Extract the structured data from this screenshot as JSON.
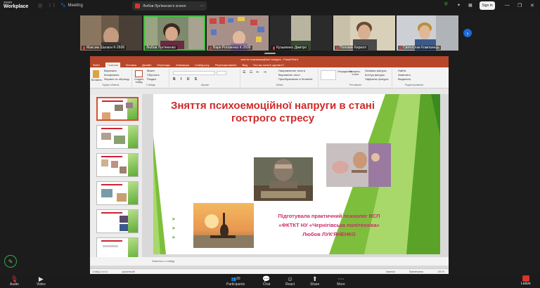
{
  "app": {
    "brand_top": "zoom",
    "brand_main": "Workplace",
    "meeting_label": "Meeting"
  },
  "share": {
    "title": "Любов Лук'яненко's screen"
  },
  "top_actions": {
    "sign_in": "Sign in"
  },
  "participants": [
    {
      "name": "Максим Шалаги К-2606",
      "muted": true
    },
    {
      "name": "Любов Лук'яненко",
      "muted": false,
      "active": true
    },
    {
      "name": "Варя Роговенко К-2606",
      "muted": true
    },
    {
      "name": "Кузьменко Дмитро",
      "muted": true
    },
    {
      "name": "Поповик Кирилл",
      "muted": true
    },
    {
      "name": "Святослав Компанець",
      "muted": true
    }
  ],
  "ppt": {
    "window_title": "зняття психоемоційної напруги - PowerPoint",
    "tabs": [
      "Файл",
      "Главная",
      "Вставка",
      "Дизайн",
      "Переходы",
      "Анимация",
      "Слайд-шоу",
      "Рецензирование",
      "Вид",
      "Что вы хотите сделать?"
    ],
    "selected_tab": "Главная",
    "ribbon_groups": {
      "clipboard": {
        "label": "Буфер обмена",
        "items": [
          "Вырезать",
          "Копировать",
          "Формат по образцу"
        ],
        "paste": "Вставить"
      },
      "slides": {
        "label": "Слайды",
        "items": [
          "Макет",
          "Сбросить",
          "Раздел"
        ],
        "new": "Создать слайд"
      },
      "font": {
        "label": "Шрифт"
      },
      "paragraph": {
        "label": "Абзац",
        "items": [
          "Направление текста",
          "Выровнять текст",
          "Преобразовать в SmartArt"
        ]
      },
      "drawing": {
        "label": "Рисование",
        "items": [
          "Упорядочить",
          "Экспресс-стили",
          "Заливка фигуры",
          "Контур фигуры",
          "Эффекты фигуры"
        ]
      },
      "editing": {
        "label": "Редактирование",
        "items": [
          "Найти",
          "Заменить",
          "Выделить"
        ]
      }
    },
    "slide": {
      "title": "Зняття психоемоційної напруги в стані гострого стресу",
      "info_lines": [
        "Підготувала практичний психолог ВСП",
        "«ФКТКТ НУ «Чернігівська політехніка»",
        "Любов ЛУК'ЯНЕНКО"
      ],
      "bullet": "➤"
    },
    "slide_count": 7,
    "notes_placeholder": "Заметки к слайду",
    "status": {
      "slide_of": "Слайд 1 из 11",
      "language": "украинский",
      "notes": "Заметки",
      "comments": "Примечания",
      "zoom": "100 %"
    }
  },
  "toolbar": {
    "audio": "Audio",
    "video": "Video",
    "participants": "Participants",
    "participants_count": "20",
    "chat": "Chat",
    "react": "React",
    "share": "Share",
    "more": "More",
    "leave": "Leave"
  },
  "colors": {
    "accent_green": "#3ac23a",
    "zoom_blue": "#1e6ad6",
    "ppt_red": "#b7472a",
    "leave_red": "#d9342b",
    "title_red": "#d02a2a"
  }
}
